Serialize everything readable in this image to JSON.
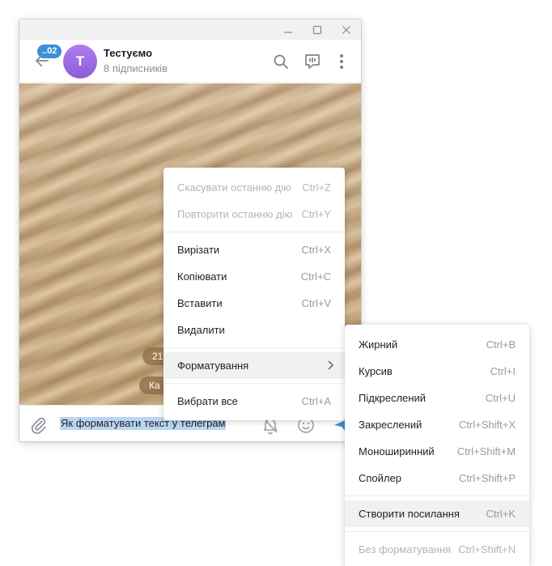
{
  "window": {
    "controls": {
      "minimize": "minimize-icon",
      "maximize": "maximize-icon",
      "close": "close-icon"
    }
  },
  "header": {
    "unread_count": "..02",
    "avatar_letter": "Т",
    "title": "Тестуємо",
    "subtitle": "8 підписників",
    "icons": [
      "search-icon",
      "discussion-icon",
      "more-icon"
    ],
    "avatar_color": "#9b6ee6",
    "accent": "#3a8fd6"
  },
  "chat": {
    "date_pill": "21",
    "service_pill": "Ка"
  },
  "composer": {
    "text": "Як форматувати текст у телеграм"
  },
  "context_menu": {
    "items": [
      {
        "label": "Скасувати останню дію",
        "shortcut": "Ctrl+Z",
        "disabled": true
      },
      {
        "label": "Повторити останню дію",
        "shortcut": "Ctrl+Y",
        "disabled": true
      },
      {
        "label": "Вирізати",
        "shortcut": "Ctrl+X"
      },
      {
        "label": "Копіювати",
        "shortcut": "Ctrl+C"
      },
      {
        "label": "Вставити",
        "shortcut": "Ctrl+V"
      },
      {
        "label": "Видалити",
        "shortcut": ""
      },
      {
        "label": "Форматування",
        "shortcut": "",
        "submenu": true
      },
      {
        "label": "Вибрати все",
        "shortcut": "Ctrl+A"
      }
    ]
  },
  "format_menu": {
    "items": [
      {
        "label": "Жирний",
        "shortcut": "Ctrl+B"
      },
      {
        "label": "Курсив",
        "shortcut": "Ctrl+I"
      },
      {
        "label": "Підкреслений",
        "shortcut": "Ctrl+U"
      },
      {
        "label": "Закреслений",
        "shortcut": "Ctrl+Shift+X"
      },
      {
        "label": "Моноширинний",
        "shortcut": "Ctrl+Shift+M"
      },
      {
        "label": "Спойлер",
        "shortcut": "Ctrl+Shift+P"
      },
      {
        "label": "Створити посилання",
        "shortcut": "Ctrl+K"
      },
      {
        "label": "Без форматування",
        "shortcut": "Ctrl+Shift+N",
        "disabled": true
      }
    ]
  }
}
